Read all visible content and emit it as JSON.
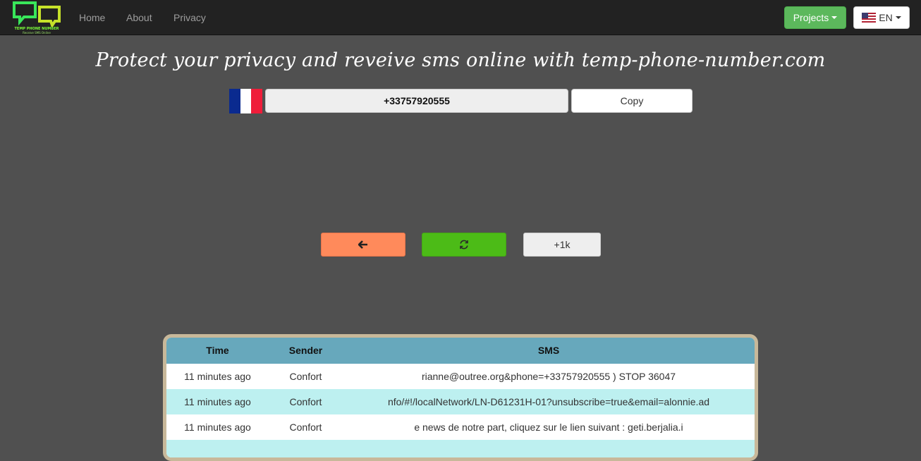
{
  "navbar": {
    "logo_text": "TEMP PHONE NUMBER",
    "logo_subtext": "Receive SMS Online",
    "links": [
      "Home",
      "About",
      "Privacy"
    ],
    "projects_label": "Projects",
    "lang_label": "EN",
    "colors": {
      "bg": "#222222",
      "projects": "#5cb85c"
    }
  },
  "headline": "Protect your privacy and reveive sms online with temp-phone-number.com",
  "phone": {
    "country_flag": "france-flag",
    "number": "+33757920555",
    "copy_label": "Copy"
  },
  "actions": {
    "back_icon": "arrow-left-icon",
    "refresh_icon": "refresh-icon",
    "more_label": "+1k",
    "colors": {
      "back": "#ff8a5b",
      "refresh": "#4cbb17"
    }
  },
  "table": {
    "headers": {
      "time": "Time",
      "sender": "Sender",
      "sms": "SMS"
    },
    "rows": [
      {
        "time": "11 minutes ago",
        "sender": "Confort",
        "sms": "rianne@outree.org&phone=+33757920555 ) STOP 36047"
      },
      {
        "time": "11 minutes ago",
        "sender": "Confort",
        "sms": "nfo/#!/localNetwork/LN-D61231H-01?unsubscribe=true&email=alonnie.ad"
      },
      {
        "time": "11 minutes ago",
        "sender": "Confort",
        "sms": "e news de notre part, cliquez sur le lien suivant : geti.berjalia.i"
      },
      {
        "time": "",
        "sender": "",
        "sms": ""
      }
    ],
    "row_colors": [
      "#ffffff",
      "#bdf0f0"
    ]
  }
}
